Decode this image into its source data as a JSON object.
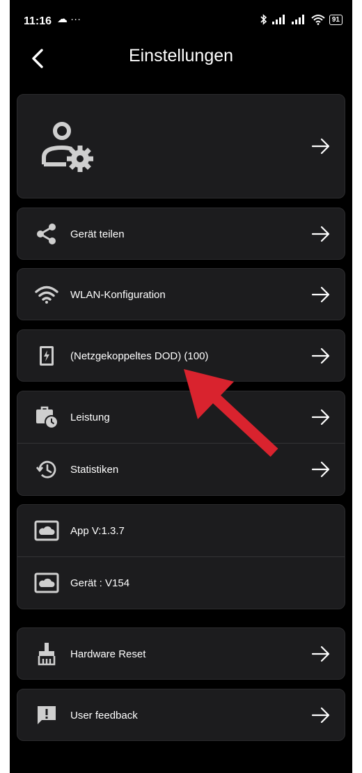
{
  "status_bar": {
    "time": "11:16",
    "left_icons": "☁ ···",
    "battery": "91"
  },
  "header": {
    "title": "Einstellungen"
  },
  "menu": {
    "share_label": "Gerät teilen",
    "wlan_label": "WLAN-Konfiguration",
    "dod_label": "(Netzgekoppeltes DOD) (100)",
    "power_label": "Leistung",
    "stats_label": "Statistiken",
    "app_version": "App V:1.3.7",
    "device_version": "Gerät : V154",
    "reset_label": "Hardware Reset",
    "feedback_label": "User feedback"
  },
  "colors": {
    "background": "#000000",
    "card": "#1c1c1e",
    "icon": "#cfcfcf",
    "annotation": "#d9232e"
  }
}
